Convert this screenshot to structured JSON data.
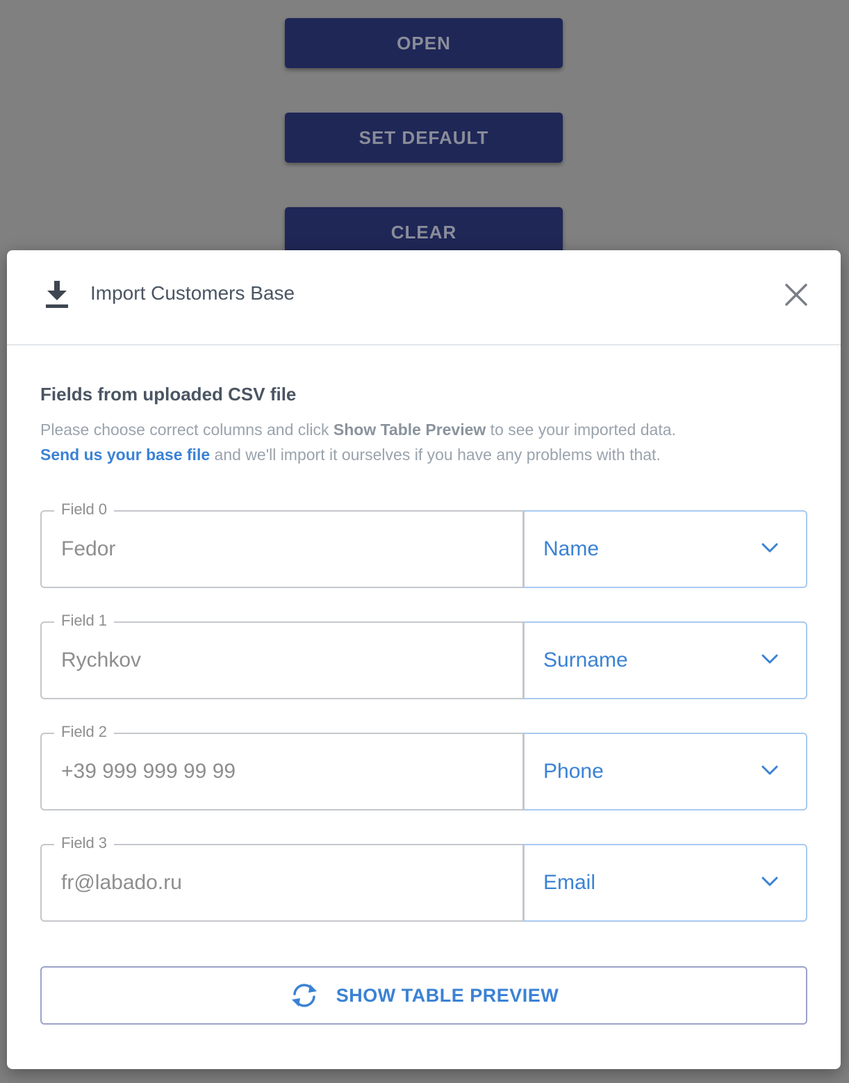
{
  "background_buttons": {
    "open": "OPEN",
    "set_default": "SET DEFAULT",
    "clear": "CLEAR"
  },
  "modal": {
    "title": "Import Customers Base",
    "icon": "download-icon",
    "close_icon": "close-icon",
    "section_title": "Fields from uploaded CSV file",
    "desc_part1": "Please choose correct columns and click ",
    "desc_bold": "Show Table Preview",
    "desc_part2": " to see your imported data.",
    "desc_link": "Send us your base file",
    "desc_part3": " and we'll import it ourselves if you have any problems with that.",
    "fields": [
      {
        "label": "Field 0",
        "value": "Fedor",
        "mapping": "Name"
      },
      {
        "label": "Field 1",
        "value": "Rychkov",
        "mapping": "Surname"
      },
      {
        "label": "Field 2",
        "value": "+39 999 999 99 99",
        "mapping": "Phone"
      },
      {
        "label": "Field 3",
        "value": "fr@labado.ru",
        "mapping": "Email"
      }
    ],
    "preview_button": "SHOW TABLE PREVIEW",
    "preview_icon": "refresh-icon"
  },
  "colors": {
    "overlay": "#808080",
    "background_button": "#1f2757",
    "accent": "#3b82d4",
    "text": "#4a5563"
  }
}
